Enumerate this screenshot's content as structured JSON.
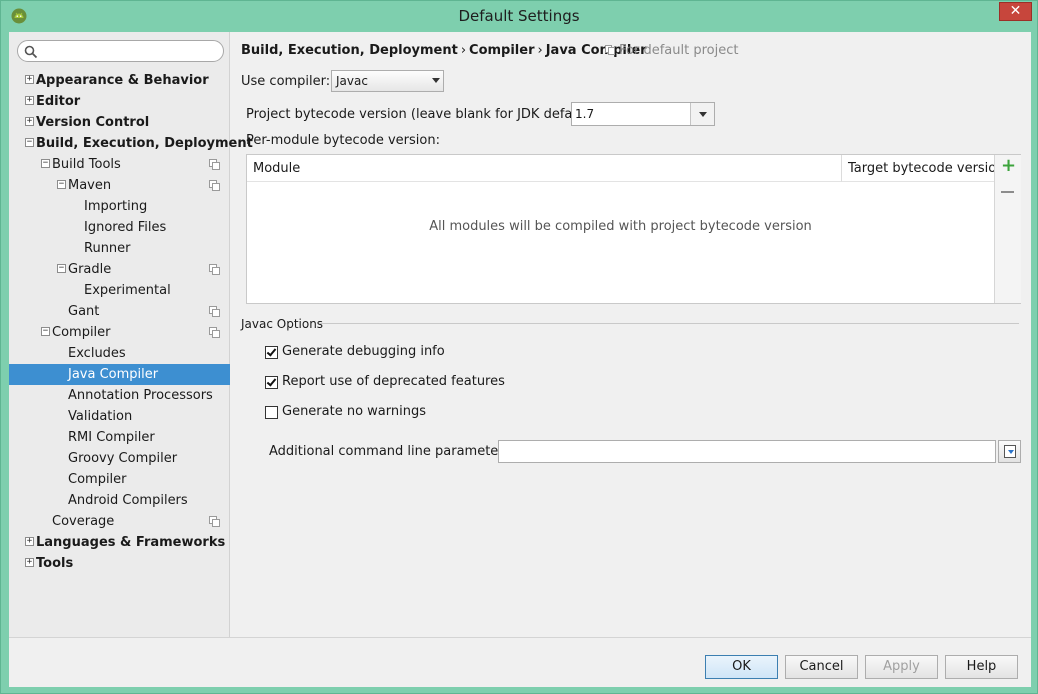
{
  "window": {
    "title": "Default Settings",
    "close_glyph": "✕",
    "icon": "android-head-icon"
  },
  "search": {
    "value": "",
    "placeholder": ""
  },
  "tree": [
    {
      "label": "Appearance & Behavior",
      "level": 0,
      "bold": true,
      "expander": "+",
      "copy": false,
      "selected": false
    },
    {
      "label": "Editor",
      "level": 0,
      "bold": true,
      "expander": "+",
      "copy": false,
      "selected": false
    },
    {
      "label": "Version Control",
      "level": 0,
      "bold": true,
      "expander": "+",
      "copy": false,
      "selected": false
    },
    {
      "label": "Build, Execution, Deployment",
      "level": 0,
      "bold": true,
      "expander": "−",
      "copy": false,
      "selected": false
    },
    {
      "label": "Build Tools",
      "level": 1,
      "bold": false,
      "expander": "−",
      "copy": true,
      "selected": false
    },
    {
      "label": "Maven",
      "level": 2,
      "bold": false,
      "expander": "−",
      "copy": true,
      "selected": false
    },
    {
      "label": "Importing",
      "level": 3,
      "bold": false,
      "expander": "",
      "copy": false,
      "selected": false
    },
    {
      "label": "Ignored Files",
      "level": 3,
      "bold": false,
      "expander": "",
      "copy": false,
      "selected": false
    },
    {
      "label": "Runner",
      "level": 3,
      "bold": false,
      "expander": "",
      "copy": false,
      "selected": false
    },
    {
      "label": "Gradle",
      "level": 2,
      "bold": false,
      "expander": "−",
      "copy": true,
      "selected": false
    },
    {
      "label": "Experimental",
      "level": 3,
      "bold": false,
      "expander": "",
      "copy": false,
      "selected": false
    },
    {
      "label": "Gant",
      "level": 2,
      "bold": false,
      "expander": "",
      "copy": true,
      "selected": false
    },
    {
      "label": "Compiler",
      "level": 1,
      "bold": false,
      "expander": "−",
      "copy": true,
      "selected": false
    },
    {
      "label": "Excludes",
      "level": 2,
      "bold": false,
      "expander": "",
      "copy": false,
      "selected": false
    },
    {
      "label": "Java Compiler",
      "level": 2,
      "bold": false,
      "expander": "",
      "copy": false,
      "selected": true
    },
    {
      "label": "Annotation Processors",
      "level": 2,
      "bold": false,
      "expander": "",
      "copy": false,
      "selected": false
    },
    {
      "label": "Validation",
      "level": 2,
      "bold": false,
      "expander": "",
      "copy": false,
      "selected": false
    },
    {
      "label": "RMI Compiler",
      "level": 2,
      "bold": false,
      "expander": "",
      "copy": false,
      "selected": false
    },
    {
      "label": "Groovy Compiler",
      "level": 2,
      "bold": false,
      "expander": "",
      "copy": false,
      "selected": false
    },
    {
      "label": "Compiler",
      "level": 2,
      "bold": false,
      "expander": "",
      "copy": false,
      "selected": false
    },
    {
      "label": "Android Compilers",
      "level": 2,
      "bold": false,
      "expander": "",
      "copy": false,
      "selected": false
    },
    {
      "label": "Coverage",
      "level": 1,
      "bold": false,
      "expander": "",
      "copy": true,
      "selected": false
    },
    {
      "label": "Languages & Frameworks",
      "level": 0,
      "bold": true,
      "expander": "+",
      "copy": false,
      "selected": false
    },
    {
      "label": "Tools",
      "level": 0,
      "bold": true,
      "expander": "+",
      "copy": false,
      "selected": false
    }
  ],
  "breadcrumb": {
    "items": [
      "Build, Execution, Deployment",
      "Compiler",
      "Java Compiler"
    ],
    "separator": "›",
    "scope": "For default project"
  },
  "compiler": {
    "use_label": "Use compiler:",
    "use_value": "Javac",
    "bytecode_label": "Project bytecode version (leave blank for JDK default):",
    "bytecode_value": "1.7",
    "per_module_label": "Per-module bytecode version:"
  },
  "module_table": {
    "columns": [
      "Module",
      "Target bytecode version"
    ],
    "rows": [],
    "empty_text": "All modules will be compiled with project bytecode version",
    "add_glyph": "+"
  },
  "javac_options": {
    "title": "Javac Options",
    "checkboxes": [
      {
        "label": "Generate debugging info",
        "checked": true
      },
      {
        "label": "Report use of deprecated features",
        "checked": true
      },
      {
        "label": "Generate no warnings",
        "checked": false
      }
    ],
    "params_label": "Additional command line parameters:",
    "params_value": ""
  },
  "footer": {
    "ok": "OK",
    "cancel": "Cancel",
    "apply": "Apply",
    "help": "Help",
    "apply_enabled": false
  },
  "colors": {
    "frame": "#7ecfae",
    "selection": "#3d8fd1",
    "add_green": "#3ca33c"
  }
}
